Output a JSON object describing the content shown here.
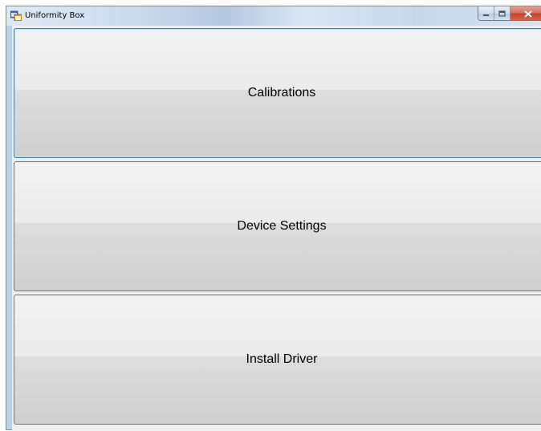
{
  "window": {
    "title": "Uniformity Box",
    "controls": {
      "minimize": "minimize-icon",
      "maximize": "maximize-icon",
      "close": "close-icon"
    }
  },
  "buttons": [
    {
      "label": "Calibrations",
      "focused": true
    },
    {
      "label": "Device Settings",
      "focused": false
    },
    {
      "label": "Install Driver",
      "focused": false
    }
  ],
  "colors": {
    "focus_border": "#3c7fb1",
    "close_button": "#c44128",
    "window_frame": "#b9d1ea"
  }
}
